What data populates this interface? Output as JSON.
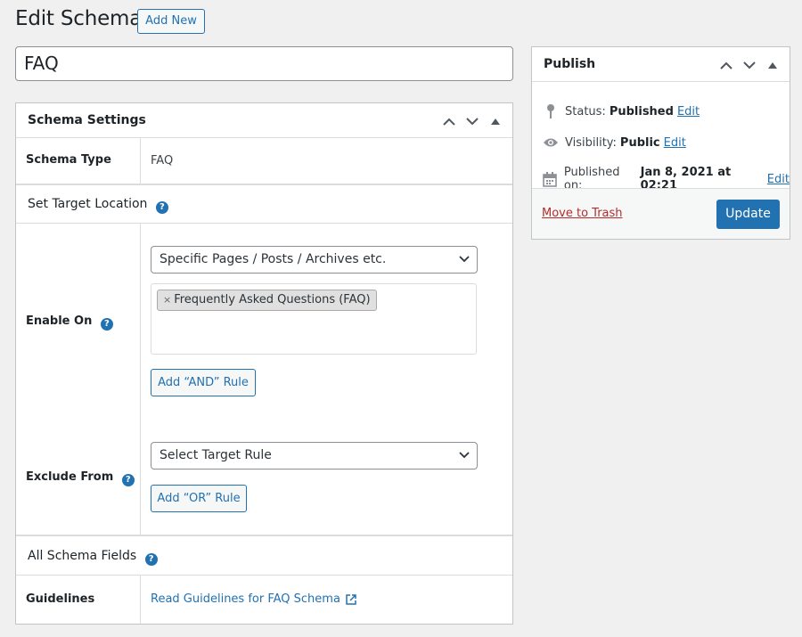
{
  "header": {
    "title": "Edit Schema",
    "add_new_label": "Add New",
    "post_title_value": "FAQ"
  },
  "schema_settings": {
    "title": "Schema Settings",
    "schema_type_label": "Schema Type",
    "schema_type_value": "FAQ",
    "target_location_title": "Set Target Location",
    "enable_on_label": "Enable On",
    "enable_on_select": "Specific Pages / Posts / Archives etc.",
    "enable_on_token": "Frequently Asked Questions (FAQ)",
    "token_remove": "×",
    "add_and_rule_label": "Add “AND” Rule",
    "exclude_from_label": "Exclude From",
    "exclude_select": "Select Target Rule",
    "add_or_rule_label": "Add “OR” Rule",
    "all_fields_title": "All Schema Fields",
    "guidelines_label": "Guidelines",
    "guidelines_link": "Read Guidelines for FAQ Schema"
  },
  "publish": {
    "title": "Publish",
    "status_label": "Status:",
    "status_value": "Published",
    "visibility_label": "Visibility:",
    "visibility_value": "Public",
    "published_on_label": "Published on:",
    "published_on_value": "Jan 8, 2021 at 02:21",
    "edit_label": "Edit",
    "trash_label": "Move to Trash",
    "update_label": "Update"
  },
  "icons": {
    "help": "help-icon",
    "collapse_up": "chevron-up-icon",
    "collapse_down": "chevron-down-icon",
    "toggle": "triangle-up-icon",
    "pin": "pin-icon",
    "eye": "eye-icon",
    "calendar": "calendar-icon",
    "external": "external-link-icon"
  },
  "colors": {
    "accent": "#2271b1",
    "danger": "#b32d2e",
    "background": "#f0f0f1"
  }
}
